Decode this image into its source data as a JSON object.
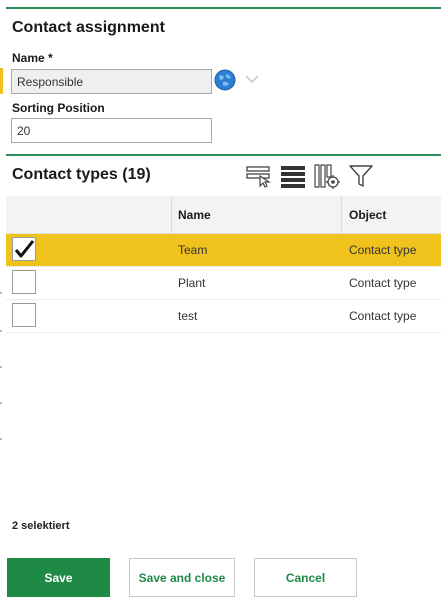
{
  "form": {
    "title": "Contact assignment",
    "name_label": "Name *",
    "name_value": "Responsible",
    "sorting_label": "Sorting Position",
    "sorting_value": "20"
  },
  "contact_types": {
    "title": "Contact types (19)",
    "toolbar_icons": [
      "filter-row-icon",
      "list-lines-icon",
      "column-settings-icon",
      "funnel-icon"
    ],
    "columns": [
      "",
      "Name",
      "Object"
    ],
    "rows": [
      {
        "name": "Team",
        "object": "Contact type",
        "checked": true
      },
      {
        "name": "Plant",
        "object": "Contact type",
        "checked": false
      },
      {
        "name": "test",
        "object": "Contact type",
        "checked": false
      }
    ],
    "selected_text": "2 selektiert"
  },
  "buttons": {
    "save": "Save",
    "save_close": "Save and close",
    "cancel": "Cancel"
  },
  "colors": {
    "accent_green": "#1f8a46",
    "selected_row": "#f0c21c",
    "globe": "#2a7fd4"
  }
}
